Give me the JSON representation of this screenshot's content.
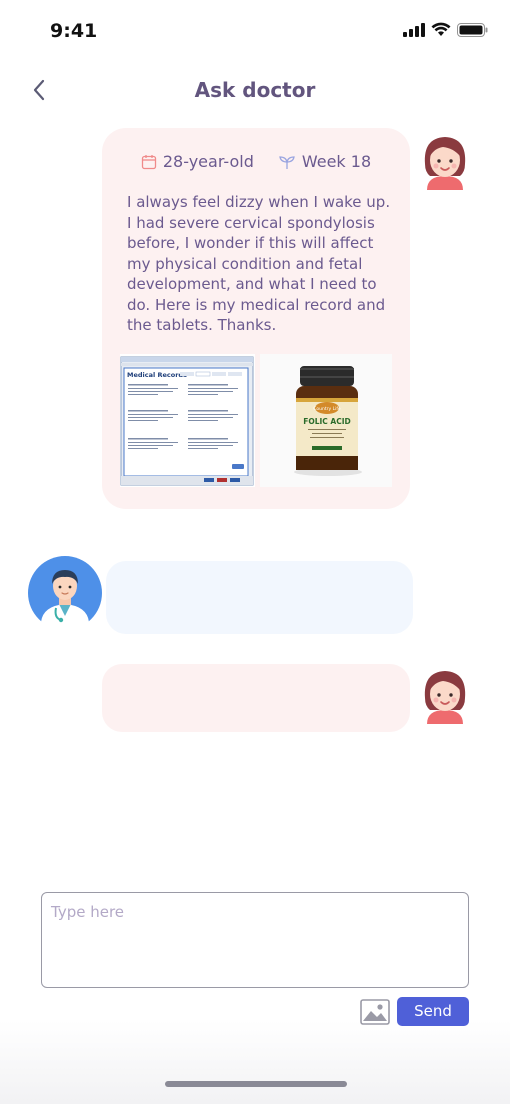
{
  "status": {
    "time": "9:41"
  },
  "nav": {
    "title": "Ask doctor"
  },
  "patient_message": {
    "age": "28-year-old",
    "week": "Week 18",
    "text": "I always feel dizzy when I wake up. I had severe cervical spondylosis before, I wonder if this will affect my physical condition and fetal development, and what I need to do. Here is my medical record and the tablets. Thanks.",
    "attachments": [
      {
        "title": "Medical Records"
      },
      {
        "brand": "Country Life",
        "label": "FOLIC ACID"
      }
    ]
  },
  "composer": {
    "placeholder": "Type here",
    "send_label": "Send"
  },
  "colors": {
    "accent": "#4f60d8",
    "patient_bubble": "#fdf1f1",
    "doctor_bubble": "#f2f7fe",
    "text": "#6b5a8f"
  }
}
